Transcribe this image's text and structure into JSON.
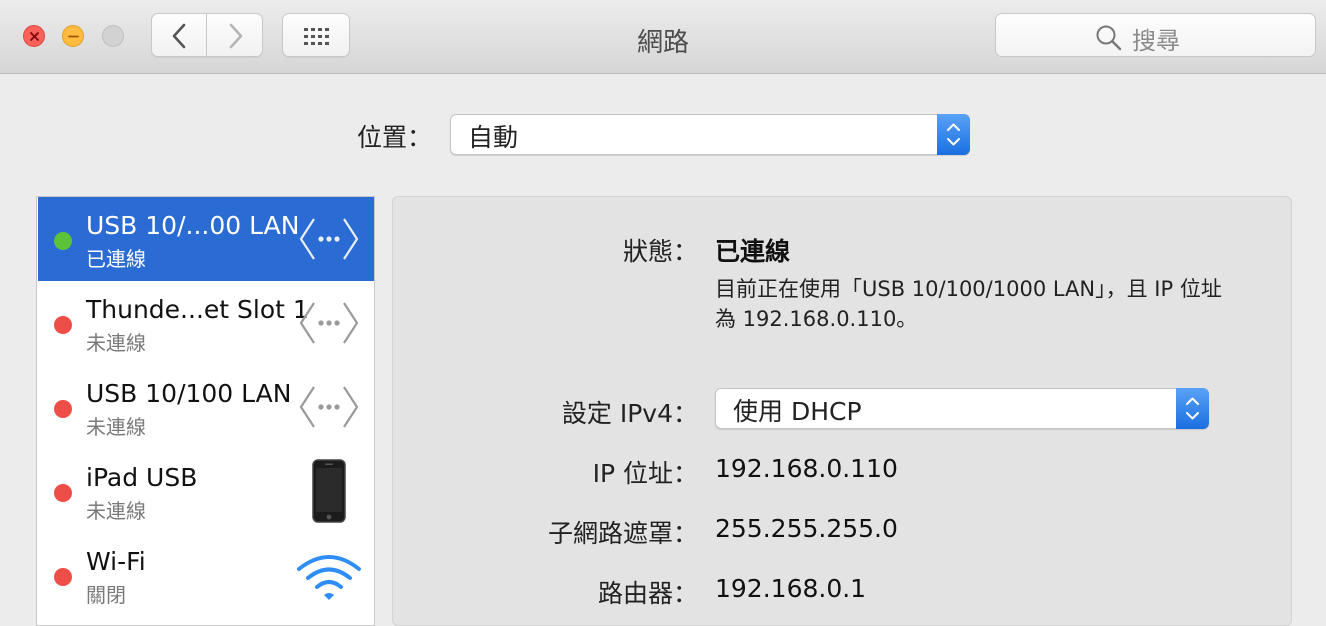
{
  "window": {
    "title": "網路",
    "search_placeholder": "搜尋"
  },
  "location": {
    "label": "位置：",
    "value": "自動"
  },
  "services": [
    {
      "name": "USB 10/...00 LAN",
      "status": "已連線",
      "dot_color": "#5ac33a",
      "icon": "ethernet-icon",
      "selected": true
    },
    {
      "name": "Thunde...et Slot 1",
      "status": "未連線",
      "dot_color": "#ee4e48",
      "icon": "ethernet-icon",
      "selected": false
    },
    {
      "name": "USB 10/100 LAN",
      "status": "未連線",
      "dot_color": "#ee4e48",
      "icon": "ethernet-icon",
      "selected": false
    },
    {
      "name": "iPad USB",
      "status": "未連線",
      "dot_color": "#ee4e48",
      "icon": "iphone-icon",
      "selected": false
    },
    {
      "name": "Wi-Fi",
      "status": "關閉",
      "dot_color": "#ee4e48",
      "icon": "wifi-icon",
      "selected": false
    }
  ],
  "detail": {
    "status_label": "狀態：",
    "status_value": "已連線",
    "status_description": "目前正在使用「USB 10/100/1000 LAN」，且 IP 位址為 192.168.0.110。",
    "ipv4_label": "設定 IPv4：",
    "ipv4_value": "使用 DHCP",
    "ip_label": "IP 位址：",
    "ip_value": "192.168.0.110",
    "subnet_label": "子網路遮罩：",
    "subnet_value": "255.255.255.0",
    "router_label": "路由器：",
    "router_value": "192.168.0.1"
  },
  "colors": {
    "selection": "#2a6bd4",
    "connected": "#5ac33a",
    "disconnected": "#ee4e48",
    "accent": "#1a6fe0"
  }
}
